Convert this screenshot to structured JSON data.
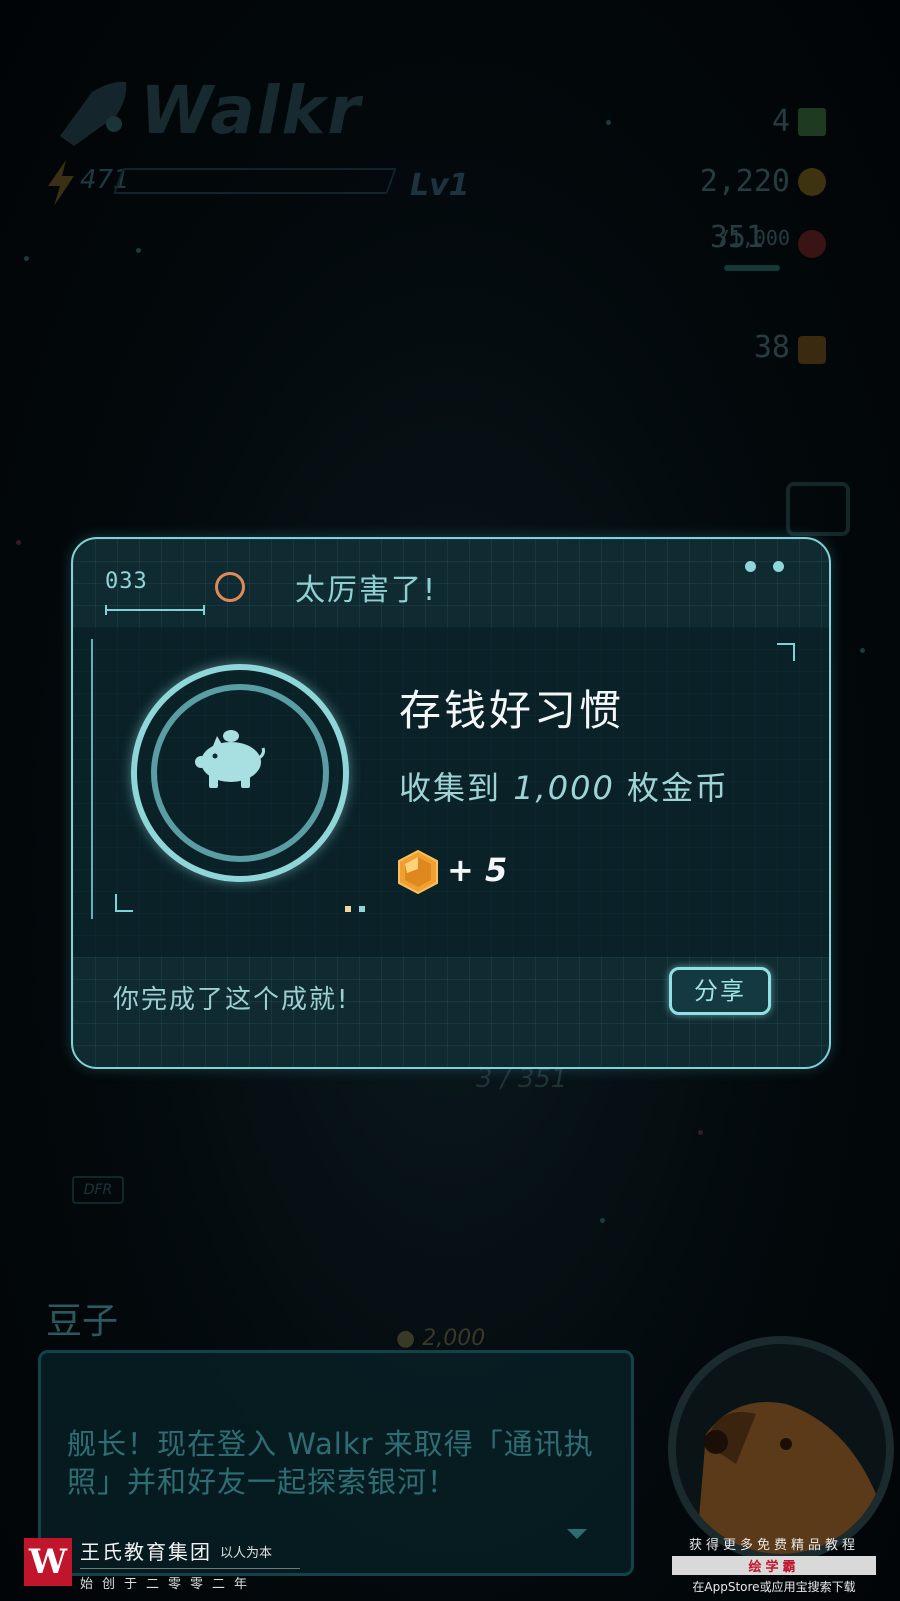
{
  "background": {
    "logo": "Walkr",
    "energy": "471",
    "level": "Lv1",
    "stats": {
      "tickets": "4",
      "coins": "2,220",
      "food": "351",
      "food_max": "/1,000",
      "cubes": "38"
    },
    "progress_text": "3 / 351",
    "dfr_label": "DFR",
    "coin_cost": "2,000",
    "speaker": "豆子",
    "dialogue": "舰长！现在登入 Walkr 来取得「通讯执照」并和好友一起探索银河！"
  },
  "achievement": {
    "code": "033",
    "header": "太厉害了!",
    "title": "存钱好习惯",
    "desc_prefix": "收集到",
    "desc_number": "1,000",
    "desc_suffix": "枚金币",
    "reward": "+ 5",
    "completed_text": "你完成了这个成就!",
    "share_label": "分享"
  },
  "watermark": {
    "logo_char": "W",
    "company": "王氏教育集团",
    "motto": "以人为本",
    "founded": "始创于二零零二年",
    "promo_line1": "获得更多免费精品教程",
    "promo_brand": "绘学霸",
    "promo_line3": "在AppStore或应用宝搜索下载"
  },
  "colors": {
    "accent": "#7fd3d6",
    "modal_bg": "#102a31",
    "orange_ring": "#e08a5c",
    "watermark_red": "#c0152b"
  },
  "icons": [
    "rocket-icon",
    "lightning-icon",
    "ticket-icon",
    "coin-icon",
    "tomato-icon",
    "cube-icon",
    "camera-icon",
    "piggy-bank-icon",
    "gem-icon",
    "chevron-down-icon"
  ]
}
